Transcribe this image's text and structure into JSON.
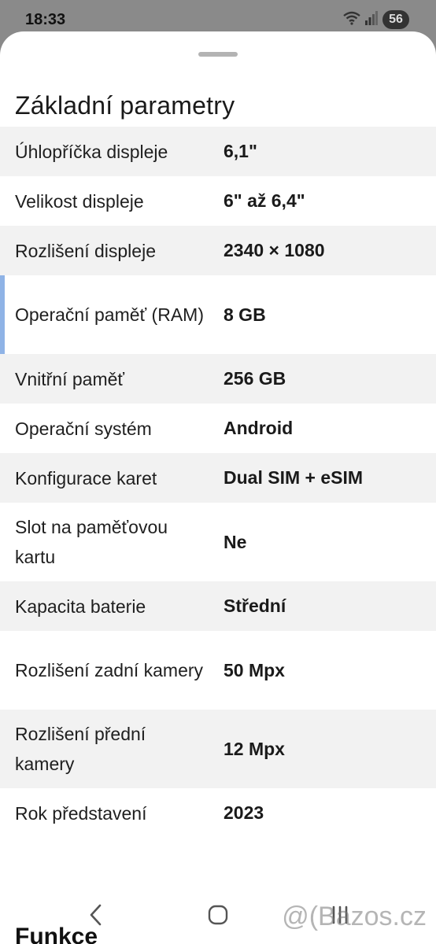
{
  "status_bar": {
    "time": "18:33",
    "battery": "56"
  },
  "section": {
    "title": "Základní parametry",
    "rows": [
      {
        "label": "Úhlopříčka displeje",
        "value": "6,1\""
      },
      {
        "label": "Velikost displeje",
        "value": "6\" až 6,4\""
      },
      {
        "label": "Rozlišení displeje",
        "value": "2340 × 1080"
      },
      {
        "label": "Operační paměť (RAM)",
        "value": "8 GB"
      },
      {
        "label": "Vnitřní paměť",
        "value": "256 GB"
      },
      {
        "label": "Operační systém",
        "value": "Android"
      },
      {
        "label": "Konfigurace karet",
        "value": "Dual SIM + eSIM"
      },
      {
        "label": "Slot na paměťovou kartu",
        "value": "Ne"
      },
      {
        "label": "Kapacita baterie",
        "value": "Střední"
      },
      {
        "label": "Rozlišení zadní kamery",
        "value": "50 Mpx"
      },
      {
        "label": "Rozlišení přední kamery",
        "value": "12 Mpx"
      },
      {
        "label": "Rok představení",
        "value": "2023"
      }
    ]
  },
  "next_section": {
    "title": "Funkce"
  },
  "watermark": {
    "text": "Bazos.cz"
  },
  "icons": {
    "wifi": "wifi-icon",
    "signal": "signal-icon",
    "back": "back-icon",
    "home": "home-icon",
    "recents": "recents-icon"
  }
}
